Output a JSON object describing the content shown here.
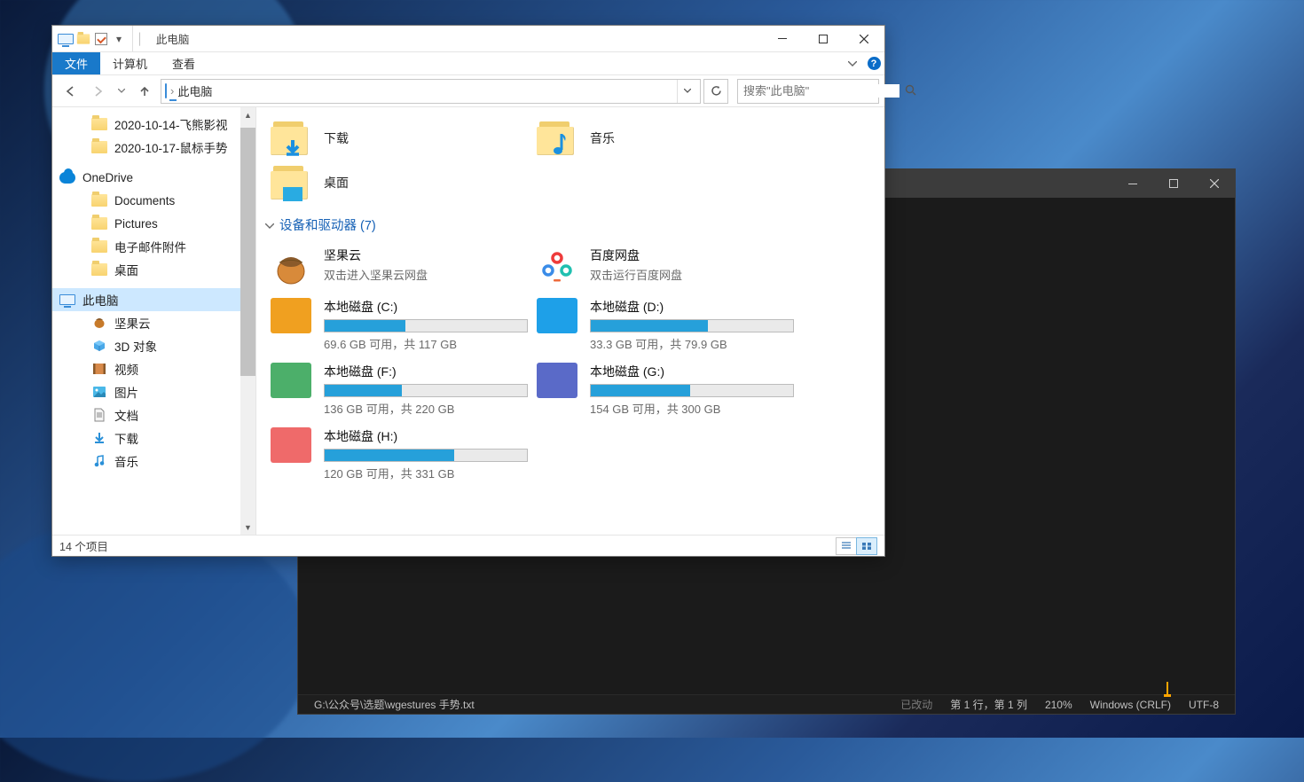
{
  "explorer": {
    "title": "此电脑",
    "tabs": {
      "file": "文件",
      "computer": "计算机",
      "view": "查看"
    },
    "nav": {
      "address_root": "此电脑",
      "search_placeholder": "搜索\"此电脑\""
    },
    "tree": {
      "quick": [
        {
          "label": "2020-10-14-飞熊影视"
        },
        {
          "label": "2020-10-17-鼠标手势"
        }
      ],
      "onedrive": "OneDrive",
      "onedrive_children": [
        "Documents",
        "Pictures",
        "电子邮件附件",
        "桌面"
      ],
      "this_pc": "此电脑",
      "this_pc_children": [
        "坚果云",
        "3D 对象",
        "视频",
        "图片",
        "文档",
        "下载",
        "音乐"
      ]
    },
    "folders": {
      "downloads": "下载",
      "music": "音乐",
      "desktop": "桌面"
    },
    "group_header": "设备和驱动器 (7)",
    "apps": {
      "nut": {
        "title": "坚果云",
        "sub": "双击进入坚果云网盘"
      },
      "baidu": {
        "title": "百度网盘",
        "sub": "双击运行百度网盘"
      }
    },
    "drives": [
      {
        "title": "本地磁盘 (C:)",
        "sub": "69.6 GB 可用，共 117 GB",
        "fill": 40,
        "color": "#f0a020"
      },
      {
        "title": "本地磁盘 (D:)",
        "sub": "33.3 GB 可用，共 79.9 GB",
        "fill": 58,
        "color": "#1ea0e8"
      },
      {
        "title": "本地磁盘 (F:)",
        "sub": "136 GB 可用，共 220 GB",
        "fill": 38,
        "color": "#4caf6a"
      },
      {
        "title": "本地磁盘 (G:)",
        "sub": "154 GB 可用，共 300 GB",
        "fill": 49,
        "color": "#5a6ac8"
      },
      {
        "title": "本地磁盘 (H:)",
        "sub": "120 GB 可用，共 331 GB",
        "fill": 64,
        "color": "#ef6a6a"
      }
    ],
    "status": "14 个项目"
  },
  "editor": {
    "path": "G:\\公众号\\选题\\wgestures 手势.txt",
    "modified": "已改动",
    "pos": "第 1 行，第 1 列",
    "zoom": "210%",
    "eol": "Windows (CRLF)",
    "enc": "UTF-8"
  }
}
